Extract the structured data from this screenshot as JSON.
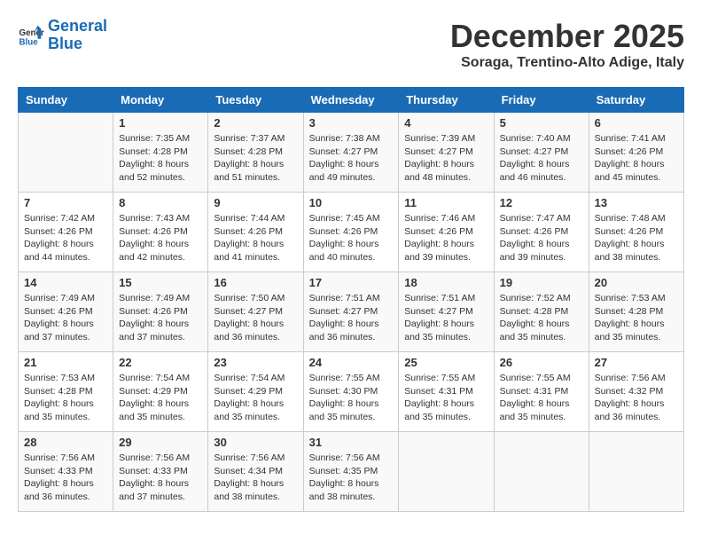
{
  "logo": {
    "line1": "General",
    "line2": "Blue"
  },
  "title": "December 2025",
  "subtitle": "Soraga, Trentino-Alto Adige, Italy",
  "days_of_week": [
    "Sunday",
    "Monday",
    "Tuesday",
    "Wednesday",
    "Thursday",
    "Friday",
    "Saturday"
  ],
  "weeks": [
    [
      {
        "day": "",
        "info": ""
      },
      {
        "day": "1",
        "info": "Sunrise: 7:35 AM\nSunset: 4:28 PM\nDaylight: 8 hours\nand 52 minutes."
      },
      {
        "day": "2",
        "info": "Sunrise: 7:37 AM\nSunset: 4:28 PM\nDaylight: 8 hours\nand 51 minutes."
      },
      {
        "day": "3",
        "info": "Sunrise: 7:38 AM\nSunset: 4:27 PM\nDaylight: 8 hours\nand 49 minutes."
      },
      {
        "day": "4",
        "info": "Sunrise: 7:39 AM\nSunset: 4:27 PM\nDaylight: 8 hours\nand 48 minutes."
      },
      {
        "day": "5",
        "info": "Sunrise: 7:40 AM\nSunset: 4:27 PM\nDaylight: 8 hours\nand 46 minutes."
      },
      {
        "day": "6",
        "info": "Sunrise: 7:41 AM\nSunset: 4:26 PM\nDaylight: 8 hours\nand 45 minutes."
      }
    ],
    [
      {
        "day": "7",
        "info": "Sunrise: 7:42 AM\nSunset: 4:26 PM\nDaylight: 8 hours\nand 44 minutes."
      },
      {
        "day": "8",
        "info": "Sunrise: 7:43 AM\nSunset: 4:26 PM\nDaylight: 8 hours\nand 42 minutes."
      },
      {
        "day": "9",
        "info": "Sunrise: 7:44 AM\nSunset: 4:26 PM\nDaylight: 8 hours\nand 41 minutes."
      },
      {
        "day": "10",
        "info": "Sunrise: 7:45 AM\nSunset: 4:26 PM\nDaylight: 8 hours\nand 40 minutes."
      },
      {
        "day": "11",
        "info": "Sunrise: 7:46 AM\nSunset: 4:26 PM\nDaylight: 8 hours\nand 39 minutes."
      },
      {
        "day": "12",
        "info": "Sunrise: 7:47 AM\nSunset: 4:26 PM\nDaylight: 8 hours\nand 39 minutes."
      },
      {
        "day": "13",
        "info": "Sunrise: 7:48 AM\nSunset: 4:26 PM\nDaylight: 8 hours\nand 38 minutes."
      }
    ],
    [
      {
        "day": "14",
        "info": "Sunrise: 7:49 AM\nSunset: 4:26 PM\nDaylight: 8 hours\nand 37 minutes."
      },
      {
        "day": "15",
        "info": "Sunrise: 7:49 AM\nSunset: 4:26 PM\nDaylight: 8 hours\nand 37 minutes."
      },
      {
        "day": "16",
        "info": "Sunrise: 7:50 AM\nSunset: 4:27 PM\nDaylight: 8 hours\nand 36 minutes."
      },
      {
        "day": "17",
        "info": "Sunrise: 7:51 AM\nSunset: 4:27 PM\nDaylight: 8 hours\nand 36 minutes."
      },
      {
        "day": "18",
        "info": "Sunrise: 7:51 AM\nSunset: 4:27 PM\nDaylight: 8 hours\nand 35 minutes."
      },
      {
        "day": "19",
        "info": "Sunrise: 7:52 AM\nSunset: 4:28 PM\nDaylight: 8 hours\nand 35 minutes."
      },
      {
        "day": "20",
        "info": "Sunrise: 7:53 AM\nSunset: 4:28 PM\nDaylight: 8 hours\nand 35 minutes."
      }
    ],
    [
      {
        "day": "21",
        "info": "Sunrise: 7:53 AM\nSunset: 4:28 PM\nDaylight: 8 hours\nand 35 minutes."
      },
      {
        "day": "22",
        "info": "Sunrise: 7:54 AM\nSunset: 4:29 PM\nDaylight: 8 hours\nand 35 minutes."
      },
      {
        "day": "23",
        "info": "Sunrise: 7:54 AM\nSunset: 4:29 PM\nDaylight: 8 hours\nand 35 minutes."
      },
      {
        "day": "24",
        "info": "Sunrise: 7:55 AM\nSunset: 4:30 PM\nDaylight: 8 hours\nand 35 minutes."
      },
      {
        "day": "25",
        "info": "Sunrise: 7:55 AM\nSunset: 4:31 PM\nDaylight: 8 hours\nand 35 minutes."
      },
      {
        "day": "26",
        "info": "Sunrise: 7:55 AM\nSunset: 4:31 PM\nDaylight: 8 hours\nand 35 minutes."
      },
      {
        "day": "27",
        "info": "Sunrise: 7:56 AM\nSunset: 4:32 PM\nDaylight: 8 hours\nand 36 minutes."
      }
    ],
    [
      {
        "day": "28",
        "info": "Sunrise: 7:56 AM\nSunset: 4:33 PM\nDaylight: 8 hours\nand 36 minutes."
      },
      {
        "day": "29",
        "info": "Sunrise: 7:56 AM\nSunset: 4:33 PM\nDaylight: 8 hours\nand 37 minutes."
      },
      {
        "day": "30",
        "info": "Sunrise: 7:56 AM\nSunset: 4:34 PM\nDaylight: 8 hours\nand 38 minutes."
      },
      {
        "day": "31",
        "info": "Sunrise: 7:56 AM\nSunset: 4:35 PM\nDaylight: 8 hours\nand 38 minutes."
      },
      {
        "day": "",
        "info": ""
      },
      {
        "day": "",
        "info": ""
      },
      {
        "day": "",
        "info": ""
      }
    ]
  ]
}
